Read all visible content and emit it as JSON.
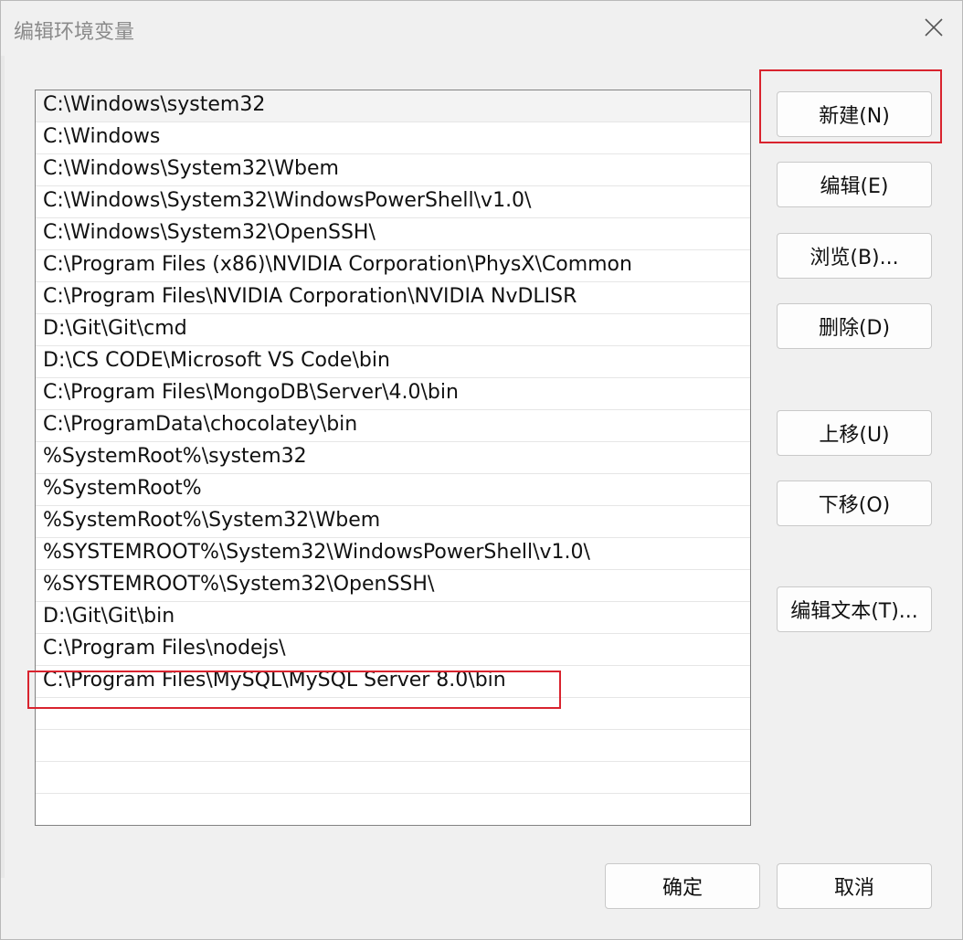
{
  "window": {
    "title": "编辑环境变量"
  },
  "paths": [
    "C:\\Windows\\system32",
    "C:\\Windows",
    "C:\\Windows\\System32\\Wbem",
    "C:\\Windows\\System32\\WindowsPowerShell\\v1.0\\",
    "C:\\Windows\\System32\\OpenSSH\\",
    "C:\\Program Files (x86)\\NVIDIA Corporation\\PhysX\\Common",
    "C:\\Program Files\\NVIDIA Corporation\\NVIDIA NvDLISR",
    "D:\\Git\\Git\\cmd",
    "D:\\CS CODE\\Microsoft VS Code\\bin",
    "C:\\Program Files\\MongoDB\\Server\\4.0\\bin",
    "C:\\ProgramData\\chocolatey\\bin",
    "%SystemRoot%\\system32",
    "%SystemRoot%",
    "%SystemRoot%\\System32\\Wbem",
    "%SYSTEMROOT%\\System32\\WindowsPowerShell\\v1.0\\",
    "%SYSTEMROOT%\\System32\\OpenSSH\\",
    "D:\\Git\\Git\\bin",
    "C:\\Program Files\\nodejs\\",
    "C:\\Program Files\\MySQL\\MySQL Server 8.0\\bin",
    "",
    "",
    "",
    ""
  ],
  "buttons": {
    "new": "新建(N)",
    "edit": "编辑(E)",
    "browse": "浏览(B)...",
    "delete": "删除(D)",
    "move_up": "上移(U)",
    "move_down": "下移(O)",
    "edit_text": "编辑文本(T)...",
    "ok": "确定",
    "cancel": "取消"
  },
  "colors": {
    "highlight": "#d9232e",
    "selected_row": "#f3f3f3"
  }
}
